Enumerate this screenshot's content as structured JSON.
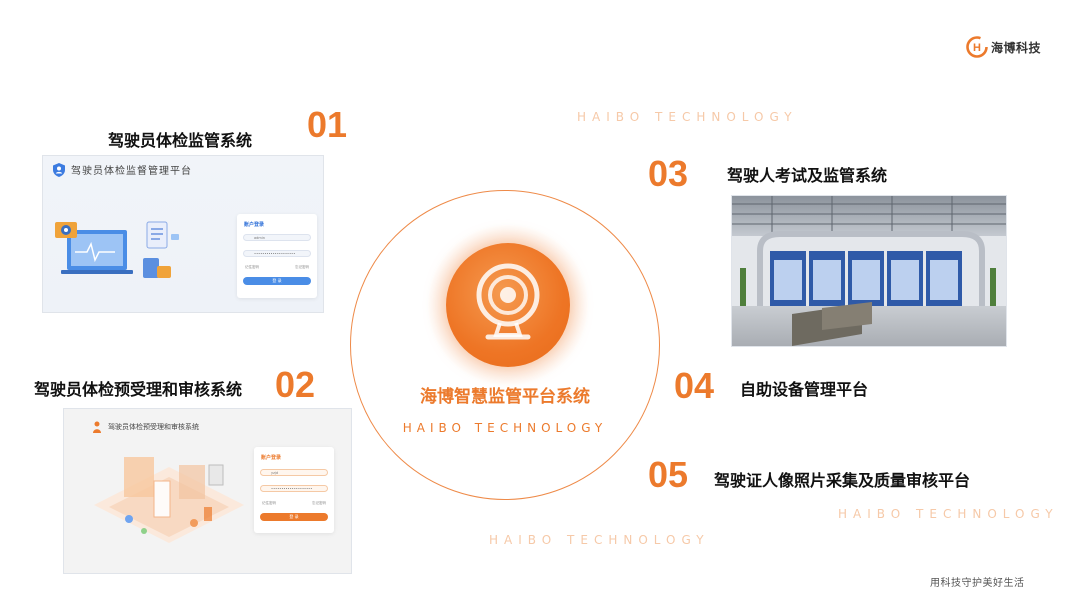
{
  "brand": {
    "logo_text": "海博科技",
    "slogan": "用科技守护美好生活",
    "accent": "#ec7a2c"
  },
  "watermark": {
    "text": "HAIBO TECHNOLOGY"
  },
  "center": {
    "title": "海博智慧监管平台系统",
    "subtitle": "HAIBO TECHNOLOGY",
    "icon": "webcam-icon"
  },
  "sections": [
    {
      "number": "01",
      "title": "驾驶员体检监管系统",
      "screenshot": {
        "header": "驾驶员体检监督管理平台",
        "login_title": "账户登录",
        "username": "admin",
        "password": "••••••••••••••••••••",
        "remember": "记住密码",
        "forgot": "忘记密码",
        "button": "登 录"
      }
    },
    {
      "number": "02",
      "title": "驾驶员体检预受理和审核系统",
      "screenshot": {
        "header": "驾驶员体检预受理和审核系统",
        "login_title": "账户登录",
        "username": "yzjd",
        "password": "••••••••••••••••••••",
        "remember": "记住密码",
        "forgot": "忘记密码",
        "button": "登 录"
      }
    },
    {
      "number": "03",
      "title": "驾驶人考试及监管系统"
    },
    {
      "number": "04",
      "title": "自助设备管理平台"
    },
    {
      "number": "05",
      "title": "驾驶证人像照片采集及质量审核平台"
    }
  ]
}
